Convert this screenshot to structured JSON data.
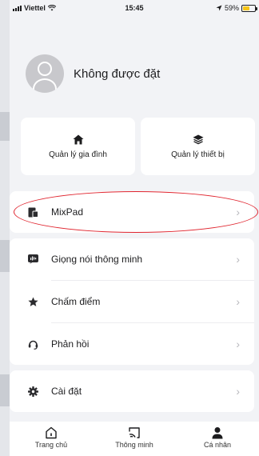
{
  "status_bar": {
    "carrier": "Viettel",
    "time": "15:45",
    "battery": "59%",
    "battery_level": 0.59
  },
  "profile": {
    "name": "Không được đặt"
  },
  "quick_actions": [
    {
      "label": "Quản lý gia đình",
      "icon": "home-icon"
    },
    {
      "label": "Quản lý thiết bị",
      "icon": "layers-icon"
    }
  ],
  "menu": {
    "mixpad": "MixPad",
    "voice": "Giọng nói thông minh",
    "rating": "Chấm điểm",
    "feedback": "Phản hồi",
    "settings": "Cài đặt"
  },
  "tabs": [
    {
      "label": "Trang chủ",
      "icon": "home-outline-icon"
    },
    {
      "label": "Thông minh",
      "icon": "smart-icon"
    },
    {
      "label": "Cá nhân",
      "icon": "person-icon",
      "active": true
    }
  ],
  "colors": {
    "accent_battery": "#f6c417",
    "highlight": "#e0252f"
  }
}
